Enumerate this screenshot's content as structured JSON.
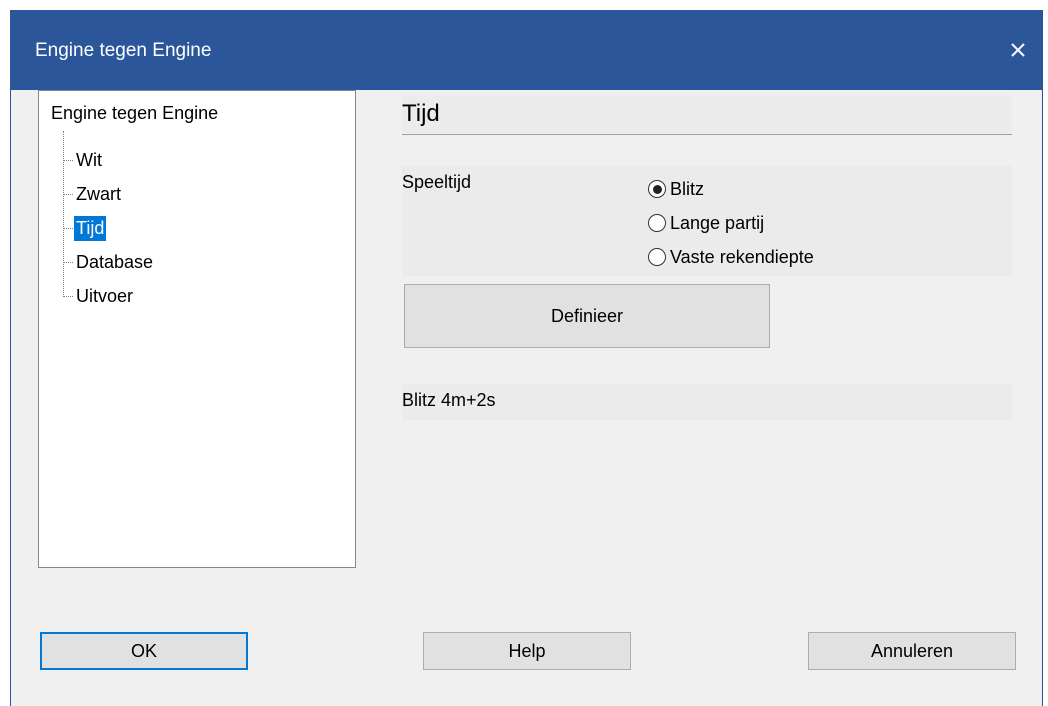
{
  "window": {
    "title": "Engine tegen Engine",
    "close_glyph": "✕"
  },
  "tree": {
    "root": "Engine tegen Engine",
    "items": [
      {
        "label": "Wit",
        "selected": false
      },
      {
        "label": "Zwart",
        "selected": false
      },
      {
        "label": "Tijd",
        "selected": true
      },
      {
        "label": "Database",
        "selected": false
      },
      {
        "label": "Uitvoer",
        "selected": false
      }
    ]
  },
  "panel": {
    "title": "Tijd",
    "speeltijd_label": "Speeltijd",
    "radios": [
      {
        "label": "Blitz",
        "checked": true
      },
      {
        "label": "Lange partij",
        "checked": false
      },
      {
        "label": "Vaste rekendiepte",
        "checked": false
      }
    ],
    "define_button": "Definieer",
    "summary": "Blitz 4m+2s"
  },
  "footer": {
    "ok": "OK",
    "help": "Help",
    "cancel": "Annuleren"
  },
  "colors": {
    "titlebar": "#2b579a",
    "selection": "#0078d7",
    "dialog_bg": "#f0f0f0",
    "button_bg": "#e1e1e1"
  }
}
